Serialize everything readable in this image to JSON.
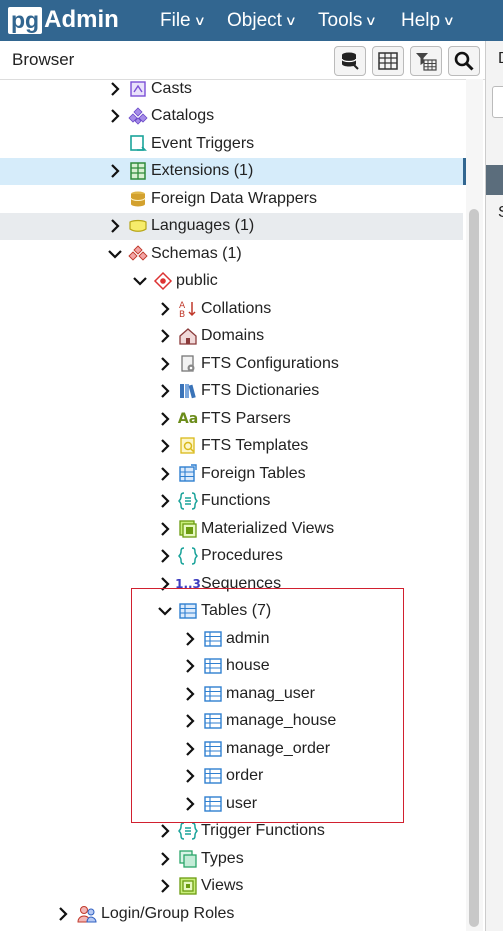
{
  "app": {
    "logo_pg": "pg",
    "logo_admin": "Admin"
  },
  "menu": [
    {
      "label": "File"
    },
    {
      "label": "Object"
    },
    {
      "label": "Tools"
    },
    {
      "label": "Help"
    }
  ],
  "browser": {
    "title": "Browser"
  },
  "right_panel": {
    "tab_letter": "D",
    "row_letter": "S"
  },
  "toolbar_icons": [
    "database-query-icon",
    "table-view-icon",
    "filtered-rows-icon",
    "search-icon"
  ],
  "tree": [
    {
      "label": "Casts",
      "icon": "casts-icon",
      "expander": "collapsed"
    },
    {
      "label": "Catalogs",
      "icon": "catalogs-icon",
      "expander": "collapsed"
    },
    {
      "label": "Event Triggers",
      "icon": "event-triggers-icon",
      "expander": "none"
    },
    {
      "label": "Extensions (1)",
      "icon": "extensions-icon",
      "expander": "collapsed",
      "state": "selected"
    },
    {
      "label": "Foreign Data Wrappers",
      "icon": "foreign-data-wrappers-icon",
      "expander": "none"
    },
    {
      "label": "Languages (1)",
      "icon": "languages-icon",
      "expander": "collapsed",
      "state": "hover"
    },
    {
      "label": "Schemas (1)",
      "icon": "schemas-icon",
      "expander": "expanded"
    },
    {
      "label": "public",
      "icon": "schema-public-icon",
      "expander": "expanded"
    },
    {
      "label": "Collations",
      "icon": "collations-icon",
      "expander": "collapsed"
    },
    {
      "label": "Domains",
      "icon": "domains-icon",
      "expander": "collapsed"
    },
    {
      "label": "FTS Configurations",
      "icon": "fts-configurations-icon",
      "expander": "collapsed"
    },
    {
      "label": "FTS Dictionaries",
      "icon": "fts-dictionaries-icon",
      "expander": "collapsed"
    },
    {
      "label": "FTS Parsers",
      "icon": "fts-parsers-icon",
      "expander": "collapsed"
    },
    {
      "label": "FTS Templates",
      "icon": "fts-templates-icon",
      "expander": "collapsed"
    },
    {
      "label": "Foreign Tables",
      "icon": "foreign-tables-icon",
      "expander": "collapsed"
    },
    {
      "label": "Functions",
      "icon": "functions-icon",
      "expander": "collapsed"
    },
    {
      "label": "Materialized Views",
      "icon": "materialized-views-icon",
      "expander": "collapsed"
    },
    {
      "label": "Procedures",
      "icon": "procedures-icon",
      "expander": "collapsed"
    },
    {
      "label": "Sequences",
      "icon": "sequences-icon",
      "expander": "collapsed"
    },
    {
      "label": "Tables (7)",
      "icon": "tables-icon",
      "expander": "expanded"
    },
    {
      "label": "admin",
      "icon": "table-icon",
      "expander": "collapsed"
    },
    {
      "label": "house",
      "icon": "table-icon",
      "expander": "collapsed"
    },
    {
      "label": "manag_user",
      "icon": "table-icon",
      "expander": "collapsed"
    },
    {
      "label": "manage_house",
      "icon": "table-icon",
      "expander": "collapsed"
    },
    {
      "label": "manage_order",
      "icon": "table-icon",
      "expander": "collapsed"
    },
    {
      "label": "order",
      "icon": "table-icon",
      "expander": "collapsed"
    },
    {
      "label": "user",
      "icon": "table-icon",
      "expander": "collapsed"
    },
    {
      "label": "Trigger Functions",
      "icon": "trigger-functions-icon",
      "expander": "collapsed"
    },
    {
      "label": "Types",
      "icon": "types-icon",
      "expander": "collapsed"
    },
    {
      "label": "Views",
      "icon": "views-icon",
      "expander": "collapsed"
    },
    {
      "label": "Login/Group Roles",
      "icon": "login-group-roles-icon",
      "expander": "collapsed"
    }
  ],
  "colors": {
    "header": "#326690",
    "selected_row": "#d6ecfa",
    "hover_row": "#e8ebee",
    "highlight_box": "#d1202f"
  }
}
